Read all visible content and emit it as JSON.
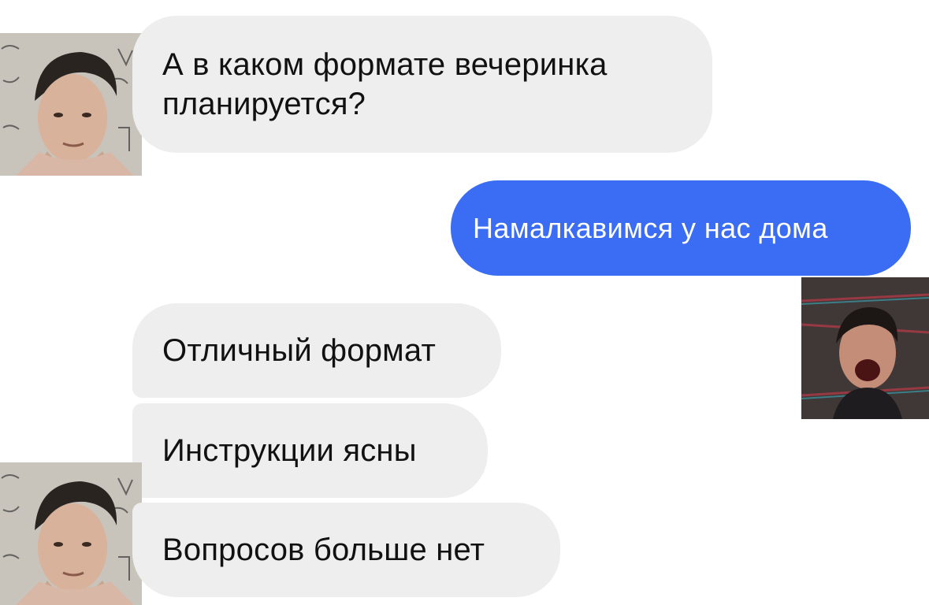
{
  "conversation": {
    "messages": [
      {
        "sender": "contact",
        "text": "А в каком формате вечеринка планируется?"
      },
      {
        "sender": "me",
        "text": "Намалкавимся у нас дома"
      },
      {
        "sender": "contact",
        "text": "Отличный формат"
      },
      {
        "sender": "contact",
        "text": "Инструкции ясны"
      },
      {
        "sender": "contact",
        "text": "Вопросов больше нет"
      }
    ]
  },
  "colors": {
    "incoming_bubble": "#eeeeee",
    "outgoing_bubble": "#3a6cf4",
    "incoming_text": "#111111",
    "outgoing_text": "#ffffff"
  },
  "icons": {
    "contact_avatar": "contact-avatar-photo",
    "my_avatar": "my-avatar-photo"
  }
}
